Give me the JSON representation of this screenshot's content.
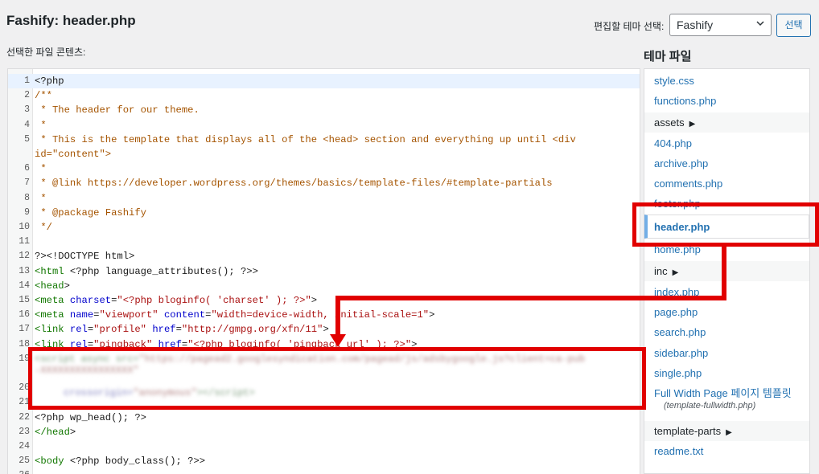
{
  "header": {
    "title": "Fashify: header.php",
    "subtitle": "선택한 파일 콘텐츠:",
    "theme_select_label": "편집할 테마 선택:",
    "theme_select_value": "Fashify",
    "select_button": "선택"
  },
  "sidebar": {
    "title": "테마 파일",
    "items": [
      {
        "label": "style.css",
        "type": "file"
      },
      {
        "label": "functions.php",
        "type": "file"
      },
      {
        "label": "assets",
        "type": "folder"
      },
      {
        "label": "404.php",
        "type": "file"
      },
      {
        "label": "archive.php",
        "type": "file"
      },
      {
        "label": "comments.php",
        "type": "file"
      },
      {
        "label": "footer.php",
        "type": "file"
      },
      {
        "label": "header.php",
        "type": "file",
        "current": true
      },
      {
        "label": "home.php",
        "type": "file"
      },
      {
        "label": "inc",
        "type": "folder"
      },
      {
        "label": "index.php",
        "type": "file"
      },
      {
        "label": "page.php",
        "type": "file"
      },
      {
        "label": "search.php",
        "type": "file"
      },
      {
        "label": "sidebar.php",
        "type": "file"
      },
      {
        "label": "single.php",
        "type": "file"
      },
      {
        "label": "Full Width Page 페이지 템플릿",
        "type": "file",
        "sub": "(template-fullwidth.php)"
      },
      {
        "label": "template-parts",
        "type": "folder"
      },
      {
        "label": "readme.txt",
        "type": "file"
      }
    ]
  },
  "editor": {
    "lines": [
      {
        "n": "1",
        "text": "<?php"
      },
      {
        "n": "2",
        "text": "/**"
      },
      {
        "n": "3",
        "text": " * The header for our theme."
      },
      {
        "n": "4",
        "text": " *"
      },
      {
        "n": "5",
        "text": " * This is the template that displays all of the <head> section and everything up until <div"
      },
      {
        "n": "",
        "text": "id=\"content\">"
      },
      {
        "n": "6",
        "text": " *"
      },
      {
        "n": "7",
        "text": " * @link https://developer.wordpress.org/themes/basics/template-files/#template-partials"
      },
      {
        "n": "8",
        "text": " *"
      },
      {
        "n": "9",
        "text": " * @package Fashify"
      },
      {
        "n": "10",
        "text": " */"
      },
      {
        "n": "11",
        "text": ""
      },
      {
        "n": "12",
        "text": "?><!DOCTYPE html>"
      },
      {
        "n": "13",
        "text": "<html <?php language_attributes(); ?>>"
      },
      {
        "n": "14",
        "text": "<head>"
      },
      {
        "n": "15",
        "text": "<meta charset=\"<?php bloginfo( 'charset' ); ?>\">"
      },
      {
        "n": "16",
        "text": "<meta name=\"viewport\" content=\"width=device-width, initial-scale=1\">"
      },
      {
        "n": "17",
        "text": "<link rel=\"profile\" href=\"http://gmpg.org/xfn/11\">"
      },
      {
        "n": "18",
        "text": "<link rel=\"pingback\" href=\"<?php bloginfo( 'pingback_url' ); ?>\">"
      },
      {
        "n": "19",
        "text": ""
      },
      {
        "n": "",
        "text": ""
      },
      {
        "n": "20",
        "text": ""
      },
      {
        "n": "21",
        "text": ""
      },
      {
        "n": "22",
        "text": "<?php wp_head(); ?>"
      },
      {
        "n": "23",
        "text": "</head>"
      },
      {
        "n": "24",
        "text": ""
      },
      {
        "n": "25",
        "text": "<body <?php body_class(); ?>>"
      },
      {
        "n": "26",
        "text": ""
      }
    ]
  },
  "colors": {
    "highlight": "#e10000",
    "link": "#2271b1",
    "comment": "#a55400",
    "tag": "#117700",
    "attr": "#0000cc",
    "string": "#aa1111"
  }
}
